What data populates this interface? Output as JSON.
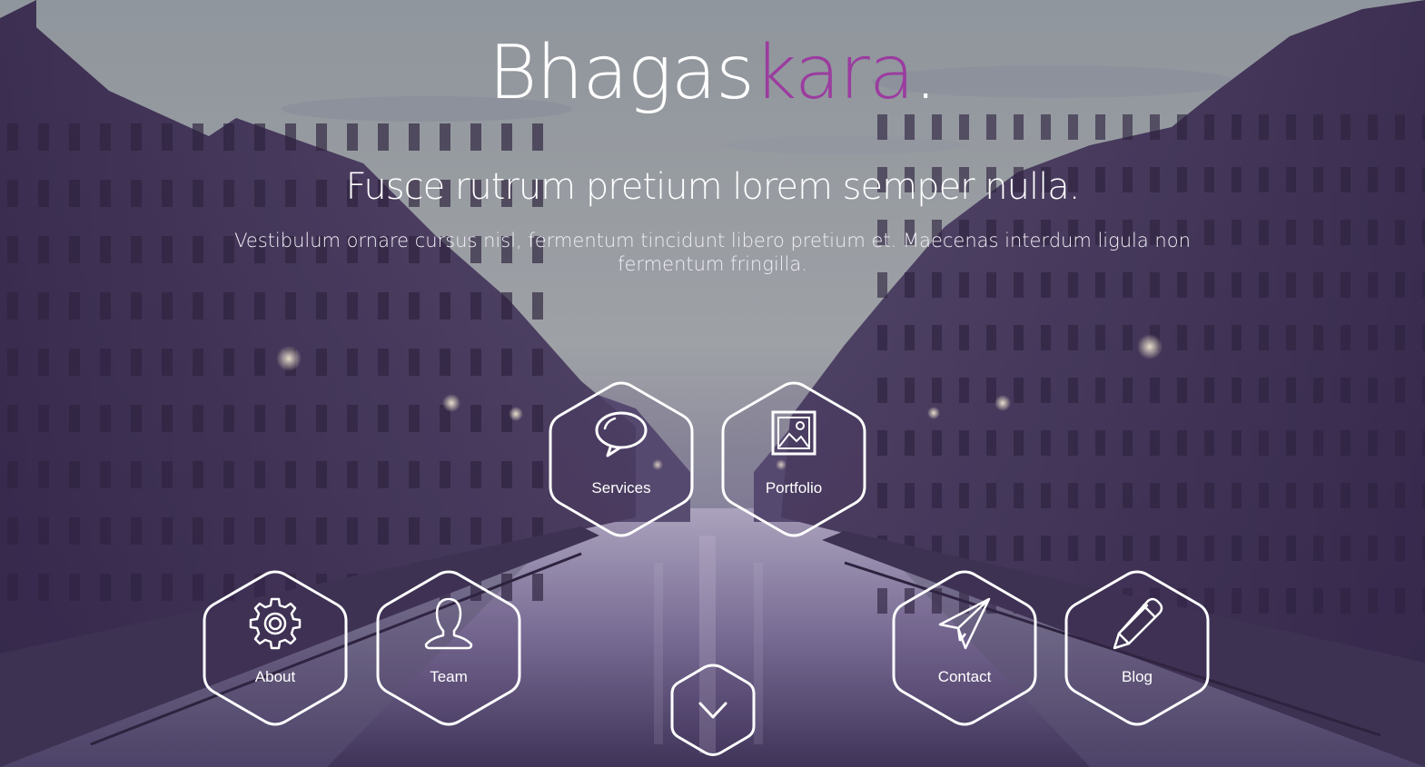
{
  "brand": {
    "name_primary": "Bhagas",
    "name_accent": "kara",
    "name_dot": ".",
    "accent_color": "#9b3c9f"
  },
  "hero": {
    "headline": "Fusce rutrum pretium lorem semper nulla.",
    "subline": "Vestibulum ornare cursus nisl, fermentum tincidunt libero pretium et. Maecenas interdum ligula non fermentum fringilla."
  },
  "nav": {
    "services": {
      "label": "Services",
      "icon": "speech-bubble-icon"
    },
    "portfolio": {
      "label": "Portfolio",
      "icon": "image-icon"
    },
    "about": {
      "label": "About",
      "icon": "gear-icon"
    },
    "team": {
      "label": "Team",
      "icon": "user-icon"
    },
    "contact": {
      "label": "Contact",
      "icon": "paper-plane-icon"
    },
    "blog": {
      "label": "Blog",
      "icon": "pencil-icon"
    }
  },
  "scroll": {
    "icon": "chevron-down-icon"
  }
}
